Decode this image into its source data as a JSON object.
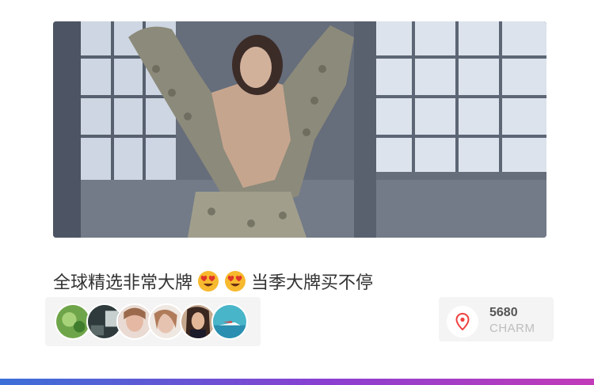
{
  "caption": {
    "text_part1": "全球精选非常大牌",
    "emoji_name": "heart-eyes-emoji",
    "text_part2": "当季大牌买不停"
  },
  "avatars": [
    {
      "name": "avatar-1"
    },
    {
      "name": "avatar-2"
    },
    {
      "name": "avatar-3"
    },
    {
      "name": "avatar-4"
    },
    {
      "name": "avatar-5"
    },
    {
      "name": "avatar-6"
    }
  ],
  "charm": {
    "value": "5680",
    "label": "CHARM",
    "icon": "location-pin-icon"
  },
  "colors": {
    "bar_start": "#3b6fd8",
    "bar_mid": "#8a3fd1",
    "bar_end": "#c23bb8",
    "pin": "#f0413f"
  }
}
